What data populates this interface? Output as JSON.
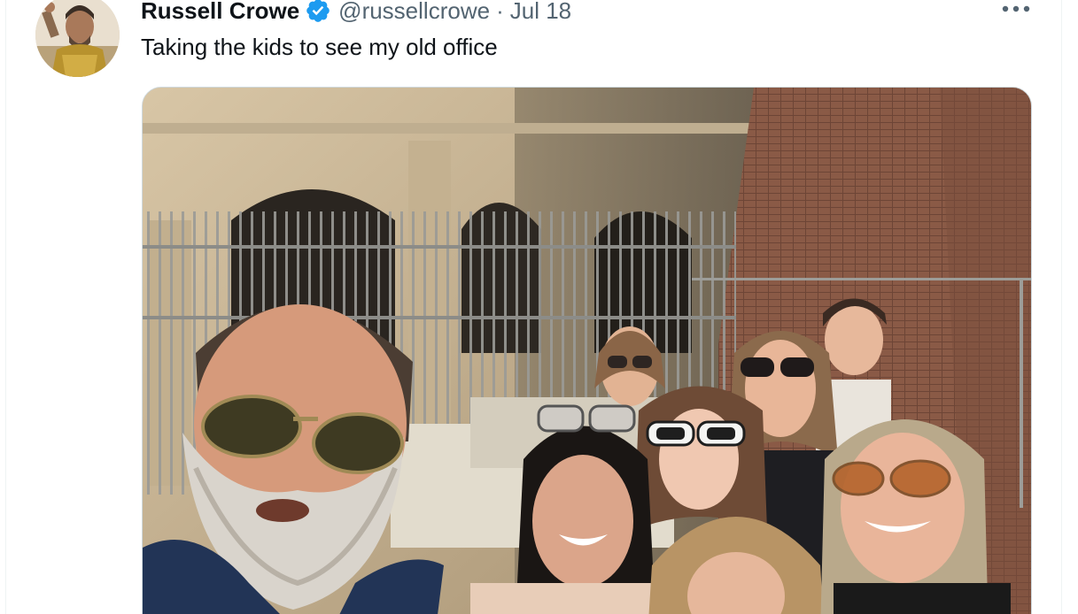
{
  "tweet": {
    "author": {
      "display_name": "Russell Crowe",
      "handle": "@russellcrowe",
      "verified": true
    },
    "separator": "·",
    "timestamp": "Jul 18",
    "text": "Taking the kids to see my old office",
    "more_icon": "more-horizontal-icon",
    "verified_icon": "verified-badge-icon"
  },
  "colors": {
    "text_primary": "#0f1419",
    "text_secondary": "#536471",
    "verified_blue": "#1d9bf0",
    "border": "#cfd9de"
  }
}
